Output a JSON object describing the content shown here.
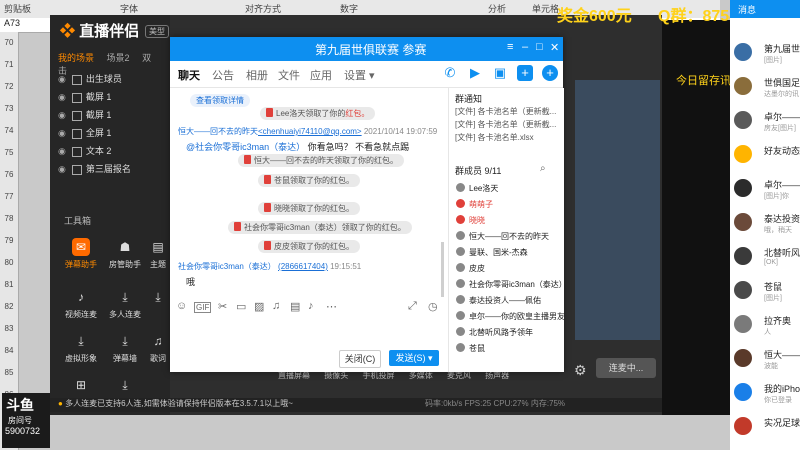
{
  "excel": {
    "cell_ref": "A73",
    "headers": [
      "剪贴板",
      "字体",
      "对齐方式",
      "数字",
      "分析",
      "单元格"
    ],
    "rows": [
      "70",
      "71",
      "72",
      "73",
      "74",
      "75",
      "76",
      "77",
      "78",
      "79",
      "80",
      "81",
      "82",
      "83",
      "84",
      "85",
      "86",
      "87",
      "88"
    ]
  },
  "banner": {
    "prize": "奖金600元",
    "qgroup": "Q群：875434520",
    "ticker": "今日留存讯"
  },
  "obs": {
    "brand": "直播伴侣",
    "brand_sub": "美型",
    "scene_tabs": [
      "我的场景",
      "场景2",
      "双击"
    ],
    "sources": [
      "出生球员",
      "截屏 1",
      "截屏 1",
      "全屏 1",
      "文本 2",
      "第三届报名"
    ],
    "tools_title": "工具箱",
    "tools": [
      "弹幕助手",
      "房管助手",
      "主题",
      "视频连麦",
      "多人连麦",
      "",
      "虚拟形象",
      "弹幕墙",
      "歌词",
      "",
      "",
      ""
    ],
    "bottom_items": [
      "直播屏幕",
      "摄像头",
      "手机投屏",
      "多媒体",
      "麦克风",
      "扬声器"
    ],
    "status": "多人连麦已支持6人连,如需体验请保持伴侣版本在3.5.7.1以上哦~",
    "stats": "码率:0kb/s  FPS:25  CPU:27%  内存:75%",
    "live_btn": "连麦中..."
  },
  "qq": {
    "title": "第九届世俱联赛 参赛",
    "tabs": [
      "聊天",
      "公告",
      "相册",
      "文件",
      "应用",
      "设置 ▾"
    ],
    "messages": {
      "m1": "查看领取详情",
      "m2_prefix": "Lee洛天",
      "m2_mid": "领取了你的",
      "m2_red": "红包。",
      "m3_name": "恒大——回不去的昨天",
      "m3_email": "<chenhuaiyi74110@qq.com>",
      "m3_time": "2021/10/14 19:07:59",
      "m3_at": "@社会你零哥ic3man（泰达）",
      "m3_text": "你看急吗？ 不看急就点踢",
      "m4": "恒大——回不去的昨天领取了你的红包。",
      "m5": "苍鼠领取了你的红包。",
      "m6": "晓晓领取了你的红包。",
      "m7": "社会你零哥ic3man（泰达）领取了你的红包。",
      "m8": "皮皮领取了你的红包。",
      "m9_name": "社会你零哥ic3man（泰达）",
      "m9_qq": "(2866617404)",
      "m9_time": "19:15:51",
      "m9_text": "哦"
    },
    "btn_close": "关闭(C)",
    "btn_send": "发送(S)",
    "notice_title": "群通知",
    "files": [
      "[文件] 各卡池名单（更新截...",
      "[文件] 各卡池名单（更新截...",
      "[文件] 各卡池名单.xlsx"
    ],
    "members_title": "群成员 9/11",
    "members": [
      "Lee洛天",
      "萌萌子",
      "晓晓",
      "恒大——回不去的昨天",
      "曼联、国米-杰森",
      "皮皮",
      "社会你零哥ic3man（泰达）",
      "泰达投资人——佩佑",
      "卓尔——你的欧皇主播男友",
      "北替听风路予领年",
      "苍鼠"
    ]
  },
  "contacts": {
    "head": "消息",
    "items": [
      {
        "name": "第九届世",
        "sub": "[图片]"
      },
      {
        "name": "世俱国足",
        "sub": "达墨尔的讯"
      },
      {
        "name": "卓尔——",
        "sub": "房友[图片]"
      },
      {
        "name": "好友动态",
        "sub": ""
      },
      {
        "name": "卓尔——",
        "sub": "[图片]你"
      },
      {
        "name": "泰达投资人",
        "sub": "哦，稍天"
      },
      {
        "name": "北替听风路",
        "sub": "[OK]"
      },
      {
        "name": "苍鼠",
        "sub": "[图片]"
      },
      {
        "name": "拉齐奥",
        "sub": "人"
      },
      {
        "name": "恒大——",
        "sub": "波能"
      },
      {
        "name": "我的iPhone",
        "sub": "你已登录"
      },
      {
        "name": "实况足球2",
        "sub": ""
      }
    ]
  },
  "douyu": {
    "logo": "斗鱼",
    "label": "房间号",
    "room": "5900732"
  }
}
